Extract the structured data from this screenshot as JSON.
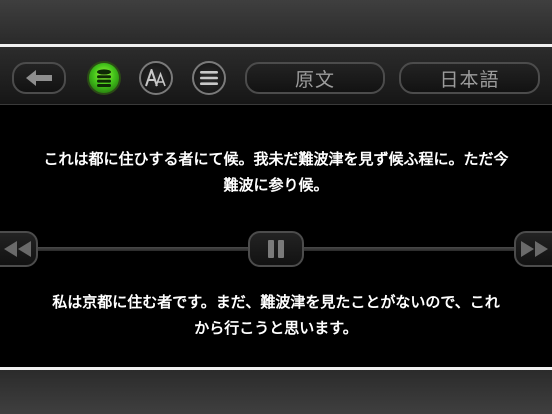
{
  "toolbar": {
    "back_icon": "left-arrow-icon",
    "database_icon": "database-icon",
    "font_icon": "font-size-icon",
    "menu_icon": "hamburger-menu-icon",
    "tab_original": "原文",
    "tab_japanese": "日本語"
  },
  "original_text": {
    "line1": "これは都に住ひする者にて候。我未だ難波津を見ず候ふ程に。ただ今",
    "line2": "難波に参り候。"
  },
  "translation_text": {
    "line1": "私は京都に住む者です。まだ、難波津を見たことがないので、これ",
    "line2": "から行こうと思います。"
  },
  "controls": {
    "rewind_icon": "rewind-icon",
    "pause_icon": "pause-icon",
    "forward_icon": "fast-forward-icon"
  },
  "colors": {
    "accent_green": "#42c21a",
    "text": "#ffffff",
    "tab_text": "#9c9c9c"
  }
}
